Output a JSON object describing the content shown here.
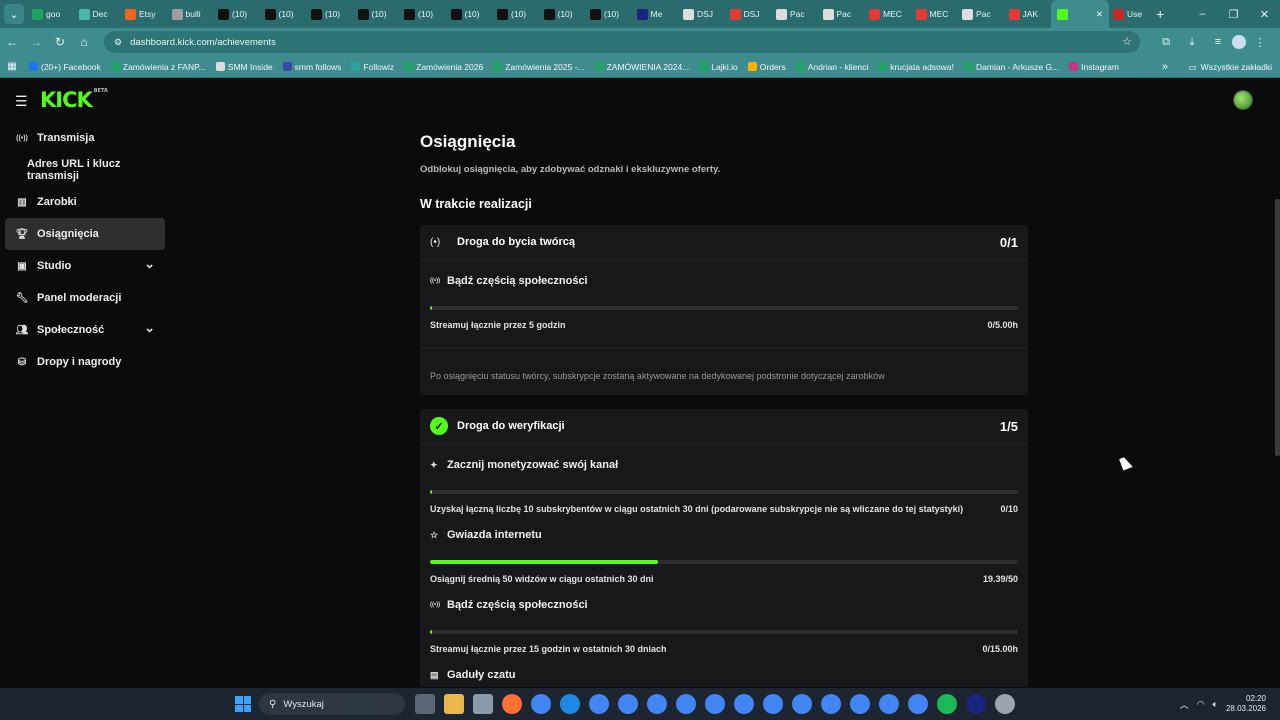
{
  "browser": {
    "tabs": [
      {
        "label": "goo",
        "color": "#1fa463"
      },
      {
        "label": "Dec",
        "color": "#4db6ac"
      },
      {
        "label": "Etsy",
        "color": "#f1641e"
      },
      {
        "label": "bulli",
        "color": "#9e9e9e"
      },
      {
        "label": "(10)",
        "color": "#111111"
      },
      {
        "label": "(10)",
        "color": "#111111"
      },
      {
        "label": "(10)",
        "color": "#111111"
      },
      {
        "label": "(10)",
        "color": "#111111"
      },
      {
        "label": "(10)",
        "color": "#111111"
      },
      {
        "label": "(10)",
        "color": "#111111"
      },
      {
        "label": "(10)",
        "color": "#111111"
      },
      {
        "label": "(10)",
        "color": "#111111"
      },
      {
        "label": "(10)",
        "color": "#111111"
      },
      {
        "label": "Me",
        "color": "#1a237e"
      },
      {
        "label": "DSJ",
        "color": "#dddddd"
      },
      {
        "label": "DSJ",
        "color": "#e53935"
      },
      {
        "label": "Pac",
        "color": "#dddddd"
      },
      {
        "label": "Pac",
        "color": "#dddddd"
      },
      {
        "label": "MEC",
        "color": "#e53935"
      },
      {
        "label": "MEC",
        "color": "#e53935"
      },
      {
        "label": "Pac",
        "color": "#dddddd"
      },
      {
        "label": "JAK",
        "color": "#e53935"
      }
    ],
    "active_tab": {
      "icon": "kick-icon",
      "close": "✕"
    },
    "last_tab": "Use",
    "url": "dashboard.kick.com/achievements",
    "bookmarks": [
      {
        "label": "(20+) Facebook",
        "color": "#1877f2"
      },
      {
        "label": "Zamówienia z FANP...",
        "color": "#1fa463"
      },
      {
        "label": "SMM Inside",
        "color": "#dddddd"
      },
      {
        "label": "smm follows",
        "color": "#3949ab"
      },
      {
        "label": "Followiz",
        "color": "#26a69a"
      },
      {
        "label": "Zamówienia 2026",
        "color": "#1fa463"
      },
      {
        "label": "Zamówienia 2025 -...",
        "color": "#1fa463"
      },
      {
        "label": "ZAMÓWIENIA 2024...",
        "color": "#1fa463"
      },
      {
        "label": "Lajki.io",
        "color": "#1fa463"
      },
      {
        "label": "Orders",
        "color": "#ffb300"
      },
      {
        "label": "Andrian - klienci",
        "color": "#1fa463"
      },
      {
        "label": "krucjata adsowa!",
        "color": "#1fa463"
      },
      {
        "label": "Damian - Arkusze G...",
        "color": "#1fa463"
      },
      {
        "label": "Instagram",
        "color": "#c13584"
      }
    ],
    "all_bookmarks": "Wszystkie zakładki"
  },
  "app": {
    "logo": "KICK",
    "logo_sup": "BETA",
    "accent": "#53fc18"
  },
  "sidebar": {
    "items": [
      {
        "label": "Transmisja",
        "icon": "broadcast-icon"
      },
      {
        "label": "Adres URL i klucz transmisji",
        "sub": true
      },
      {
        "label": "Zarobki",
        "icon": "chart-icon"
      },
      {
        "label": "Osiągnięcia",
        "icon": "trophy-icon",
        "active": true
      },
      {
        "label": "Studio",
        "icon": "studio-icon",
        "chevron": true
      },
      {
        "label": "Panel moderacji",
        "icon": "wrench-icon"
      },
      {
        "label": "Społeczność",
        "icon": "community-icon",
        "chevron": true
      },
      {
        "label": "Dropy i nagrody",
        "icon": "drops-icon"
      }
    ]
  },
  "page": {
    "title": "Osiągnięcia",
    "subtitle": "Odblokuj osiągnięcia, aby zdobywać odznaki i ekskluzywne oferty.",
    "section": "W trakcie realizacji"
  },
  "cards": [
    {
      "title": "Droga do bycia twórcą",
      "count": "0/1",
      "achievements": [
        {
          "title": "Bądź częścią społeczności",
          "desc": "Streamuj łącznie przez 5 godzin",
          "value": "0/5.00h",
          "progress": 0.0
        }
      ],
      "note": "Po osiągnięciu statusu twórcy, subskrypcje zostaną aktywowane na dedykowanej podstronie dotyczącej zarobków"
    },
    {
      "title": "Droga do weryfikacji",
      "count": "1/5",
      "achievements": [
        {
          "title": "Zacznij monetyzować swój kanał",
          "desc": "Uzyskaj łączną liczbę 10 subskrybentów w ciągu ostatnich 30 dni (podarowane subskrypcje nie są wliczane do tej statystyki)",
          "value": "0/10",
          "progress": 0.0
        },
        {
          "title": "Gwiazda internetu",
          "desc": "Osiągnij średnią 50 widzów w ciągu ostatnich 30 dni",
          "value": "19.39/50",
          "progress": 0.3878
        },
        {
          "title": "Bądź częścią społeczności",
          "desc": "Streamuj łącznie przez 15 godzin w ostatnich 30 dniach",
          "value": "0/15.00h",
          "progress": 0.0
        },
        {
          "title": "Gaduły czatu"
        }
      ]
    }
  ],
  "taskbar": {
    "search": "Wyszukaj",
    "time": "02:20",
    "date": "28.03.2026"
  }
}
